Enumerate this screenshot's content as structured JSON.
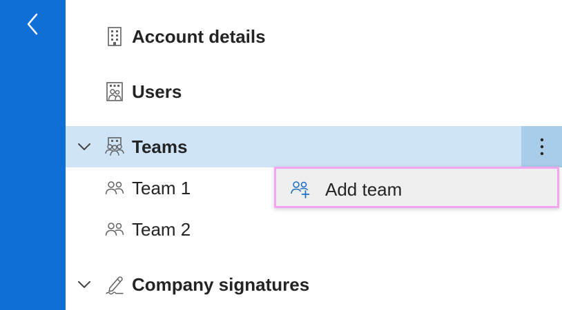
{
  "colors": {
    "rail": "#0f6fd6",
    "selected_row": "#cfe4f6",
    "more_button": "#a9cce9",
    "menu_focus_border": "#f3a6ef",
    "accent_icon": "#1a6fc4"
  },
  "nav": {
    "back_icon": "chevron-left-icon",
    "items": [
      {
        "label": "Account details",
        "icon": "building-icon"
      },
      {
        "label": "Users",
        "icon": "users-directory-icon"
      },
      {
        "label": "Teams",
        "icon": "teams-directory-icon",
        "expanded": true,
        "selected": true
      },
      {
        "label": "Team 1",
        "icon": "people-icon"
      },
      {
        "label": "Team 2",
        "icon": "people-icon"
      },
      {
        "label": "Company signatures",
        "icon": "signature-icon",
        "expanded": true
      }
    ]
  },
  "context_menu": {
    "items": [
      {
        "label": "Add team",
        "icon": "people-add-icon"
      }
    ]
  }
}
